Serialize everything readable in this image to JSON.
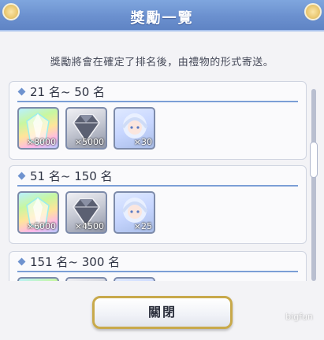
{
  "title": "獎勵一覽",
  "subtitle": "獎勵將會在確定了排名後，由禮物的形式寄送。",
  "sections": [
    {
      "rank": "21 名~ 50 名",
      "items": [
        {
          "icon": "rainbow-gem-icon",
          "qty": "×8000"
        },
        {
          "icon": "dark-crystal-icon",
          "qty": "×5000"
        },
        {
          "icon": "character-portrait-icon",
          "qty": "×30"
        }
      ]
    },
    {
      "rank": "51 名~ 150 名",
      "items": [
        {
          "icon": "rainbow-gem-icon",
          "qty": "×6000"
        },
        {
          "icon": "dark-crystal-icon",
          "qty": "×4500"
        },
        {
          "icon": "character-portrait-icon",
          "qty": "×25"
        }
      ]
    },
    {
      "rank": "151 名~ 300 名",
      "items": [
        {
          "icon": "rainbow-gem-icon",
          "qty": ""
        },
        {
          "icon": "dark-crystal-icon",
          "qty": ""
        },
        {
          "icon": "character-portrait-icon",
          "qty": ""
        }
      ]
    }
  ],
  "close_label": "關閉",
  "watermark": "bigfun",
  "colors": {
    "title_bar": "#6b90cf",
    "button_border": "#c8a94b",
    "accent": "#7b9ed6"
  }
}
